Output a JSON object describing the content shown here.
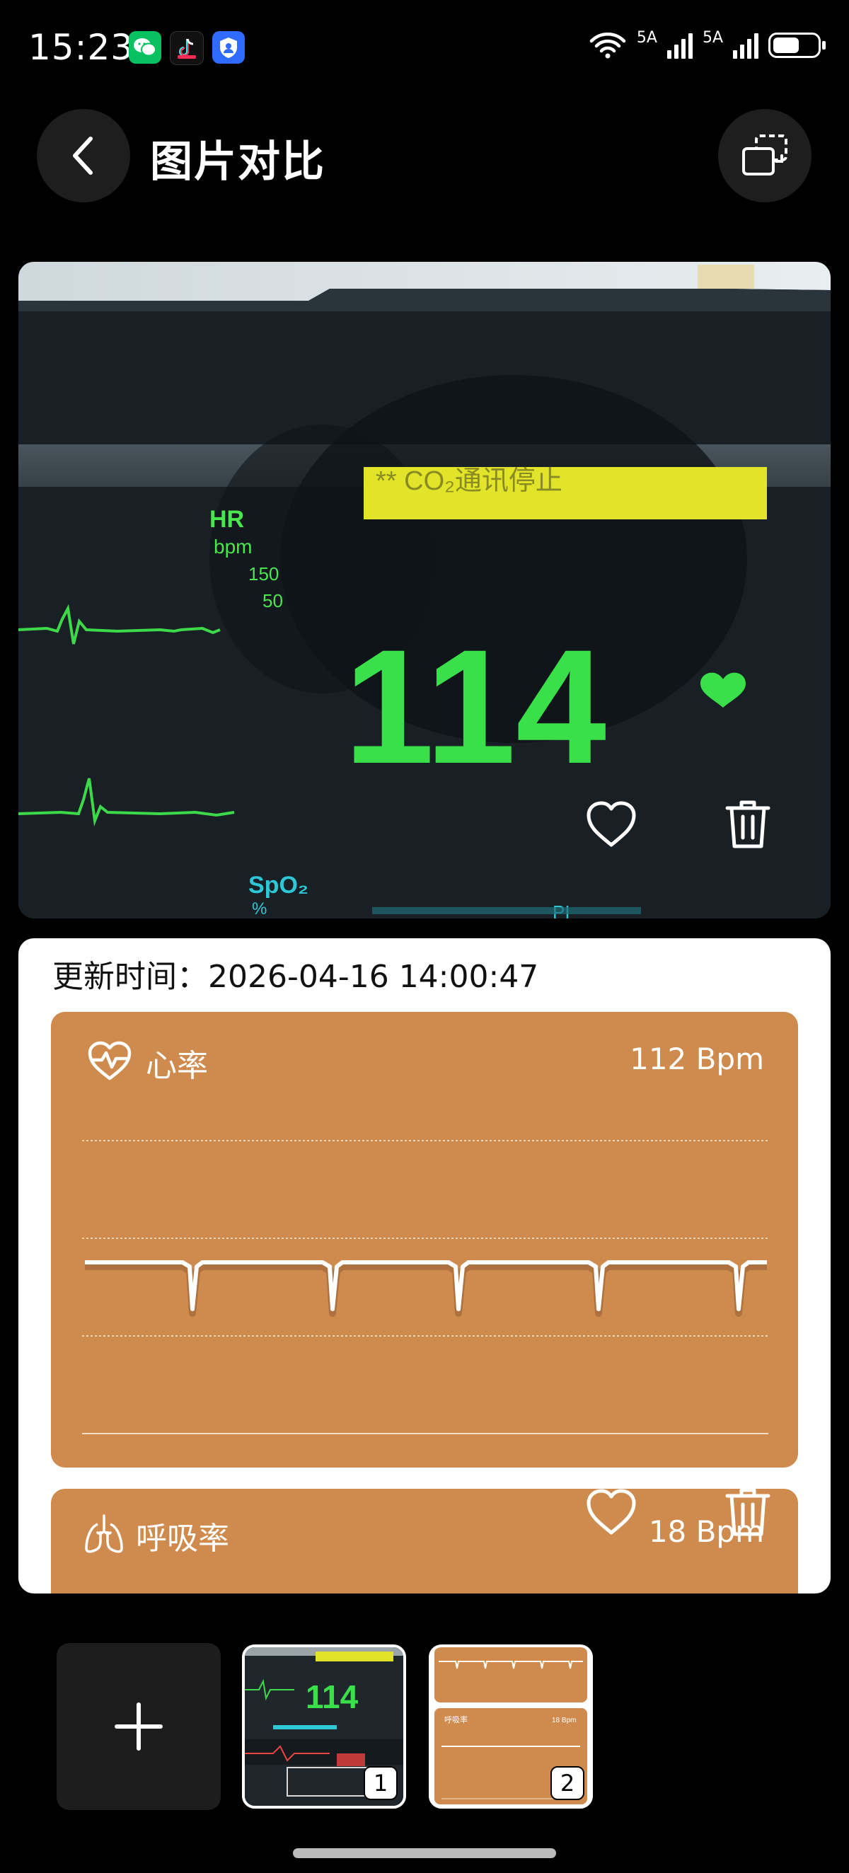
{
  "status_bar": {
    "time": "15:23",
    "net1": "5A",
    "net2": "5A",
    "battery_percent": 60,
    "icons": [
      "wechat-icon",
      "douyin-icon",
      "shield-app-icon",
      "wifi-icon",
      "signal-icon",
      "battery-icon"
    ]
  },
  "header": {
    "title": "图片对比",
    "back_icon": "chevron-left-icon",
    "compare_icon": "compare-screens-icon"
  },
  "photo": {
    "alert_text": "** CO₂通讯停止",
    "hr_label": "HR",
    "hr_unit": "bpm",
    "limit_high": "150",
    "limit_low": "50",
    "hr_value": "114",
    "spo2_label": "SpO₂",
    "spo2_unit": "%",
    "pi_label": "PI",
    "actions": [
      "heart-outline-icon",
      "trash-icon"
    ]
  },
  "data_card": {
    "updated_label": "更新时间：2026-04-16 14:00:47",
    "heart_rate": {
      "label": "心率",
      "value": "112 Bpm",
      "icon": "heartbeat-icon"
    },
    "respiration": {
      "label": "呼吸率",
      "value": "18 Bpm",
      "icon": "lungs-icon"
    },
    "colors": {
      "card": "#cf8b4e",
      "line": "#ffffff"
    }
  },
  "thumbnails": {
    "add_icon": "plus-icon",
    "items": [
      {
        "number": "1",
        "preview_text": "114"
      },
      {
        "number": "2",
        "preview_label": "呼吸率",
        "preview_value": "18 Bpm"
      }
    ]
  }
}
